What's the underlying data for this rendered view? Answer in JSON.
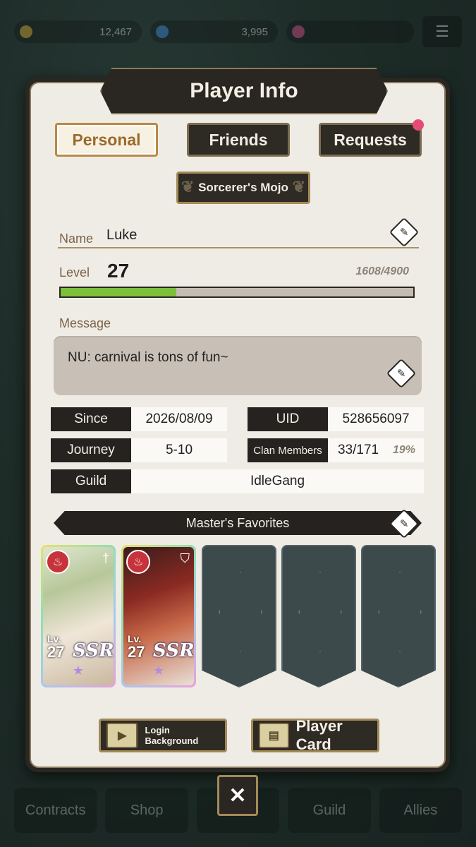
{
  "topbar": {
    "resource1": "12,467",
    "resource2": "3,995",
    "resource3": "",
    "menu_icon": "menu-icon"
  },
  "bottom_nav": [
    "Contracts",
    "Shop",
    "",
    "Guild",
    "Allies"
  ],
  "title": "Player Info",
  "tabs": [
    {
      "label": "Personal",
      "active": true
    },
    {
      "label": "Friends",
      "active": false
    },
    {
      "label": "Requests",
      "active": false,
      "notification": true
    }
  ],
  "badge": "Sorcerer's Mojo",
  "profile": {
    "name_label": "Name",
    "name": "Luke",
    "level_label": "Level",
    "level": "27",
    "exp_text": "1608/4900",
    "exp_fraction": 0.328,
    "message_label": "Message",
    "message": "NU: carnival is tons of fun~"
  },
  "info": {
    "since_label": "Since",
    "since": "2026/08/09",
    "uid_label": "UID",
    "uid": "528656097",
    "journey_label": "Journey",
    "journey": "5-10",
    "clan_label": "Clan Members",
    "clan": "33/171",
    "clan_pct": "19%",
    "guild_label": "Guild",
    "guild": "IdleGang"
  },
  "favorites": {
    "title": "Master's Favorites",
    "cards": [
      {
        "lv_label": "Lv.",
        "level": "27",
        "rarity": "SSR",
        "element_icon": "fire-icon",
        "role_icon": "sword-icon"
      },
      {
        "lv_label": "Lv.",
        "level": "27",
        "rarity": "SSR",
        "element_icon": "fire-icon",
        "role_icon": "shield-icon"
      }
    ],
    "empty_slots": 3
  },
  "buttons": {
    "login_bg": "Login Background",
    "player_card": "Player Card",
    "close": "✕"
  },
  "colors": {
    "accent_gold": "#a48a58",
    "exp_green": "#7cbf3c",
    "notification": "#e84a78",
    "dark": "#2a2621"
  }
}
